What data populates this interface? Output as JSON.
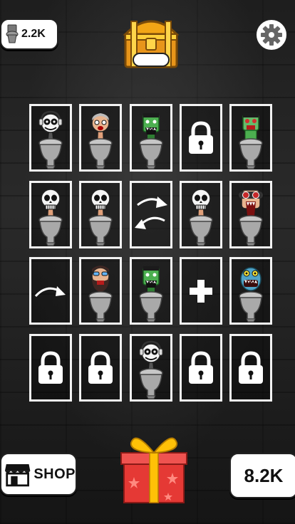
{
  "hud": {
    "coins_label": "2.2K",
    "total_label": "8.2K",
    "shop_label": "SHOP"
  },
  "grid": {
    "rows": [
      [
        "toilet-headphones",
        "toilet-scientist",
        "toilet-green-monster",
        "locked",
        "toilet-green-zombie"
      ],
      [
        "toilet-skull",
        "toilet-skull",
        "swap-arrows",
        "toilet-skull",
        "toilet-red-eyes"
      ],
      [
        "arrow",
        "toilet-bearded",
        "toilet-green-monster",
        "plus",
        "toilet-blue-monster"
      ],
      [
        "locked",
        "locked",
        "toilet-headphones",
        "locked",
        "locked"
      ]
    ]
  },
  "colors": {
    "cell_border": "#f2f2f2",
    "gift_red": "#e53935",
    "gift_ribbon": "#ffc107",
    "chest_gold": "#f2a516"
  }
}
